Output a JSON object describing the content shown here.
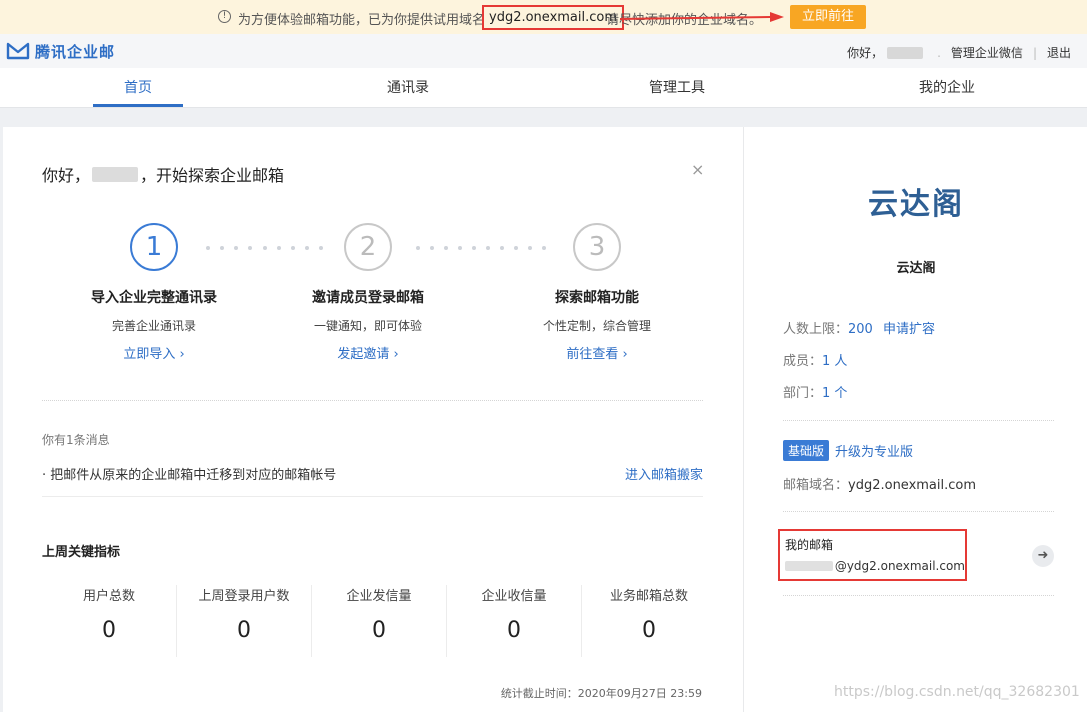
{
  "notice": {
    "icon": "info-icon",
    "text_before": "为方便体验邮箱功能，已为你提供试用域名",
    "domain": "ydg2.onexmail.com",
    "text_after": "请尽快添加你的企业域名。",
    "button": "立即前往",
    "highlight_color": "#e53935"
  },
  "header": {
    "logo_text": "腾讯企业邮",
    "greeting": "你好，",
    "links": [
      "管理企业微信",
      "退出"
    ]
  },
  "nav": {
    "tabs": [
      "首页",
      "通讯录",
      "管理工具",
      "我的企业"
    ],
    "active": "首页"
  },
  "welcome": {
    "prefix": "你好，",
    "suffix": "，开始探索企业邮箱",
    "close": "×"
  },
  "steps": [
    {
      "num": "1",
      "title": "导入企业完整通讯录",
      "desc": "完善企业通讯录",
      "link": "立即导入 ›"
    },
    {
      "num": "2",
      "title": "邀请成员登录邮箱",
      "desc": "一键通知，即可体验",
      "link": "发起邀请 ›"
    },
    {
      "num": "3",
      "title": "探索邮箱功能",
      "desc": "个性定制，综合管理",
      "link": "前往查看 ›"
    }
  ],
  "messages": {
    "count": "你有1条消息",
    "items": [
      {
        "text": "· 把邮件从原来的企业邮箱中迁移到对应的邮箱帐号",
        "action": "进入邮箱搬家"
      }
    ]
  },
  "kpi": {
    "title": "上周关键指标",
    "items": [
      {
        "label": "用户总数",
        "value": "0"
      },
      {
        "label": "上周登录用户数",
        "value": "0"
      },
      {
        "label": "企业发信量",
        "value": "0"
      },
      {
        "label": "企业收信量",
        "value": "0"
      },
      {
        "label": "业务邮箱总数",
        "value": "0"
      }
    ],
    "stat_time": "统计截止时间：2020年09月27日 23:59"
  },
  "company": {
    "logo_text": "云达阁",
    "name": "云达阁",
    "limit_label": "人数上限：",
    "limit_value": "200",
    "expand_link": "申请扩容",
    "members_label": "成员：",
    "members_value": "1 人",
    "depts_label": "部门：",
    "depts_value": "1 个",
    "edition_badge": "基础版",
    "upgrade_link": "升级为专业版",
    "domain_label": "邮箱域名：",
    "domain_value": "ydg2.onexmail.com",
    "mailbox_title": "我的邮箱",
    "mailbox_addr_suffix": "@ydg2.onexmail.com"
  },
  "watermark": "https://blog.csdn.net/qq_32682301",
  "colors": {
    "accent": "#2e6ec5",
    "warn_button": "#f8a623",
    "notice_bg": "#fdf4dd"
  }
}
